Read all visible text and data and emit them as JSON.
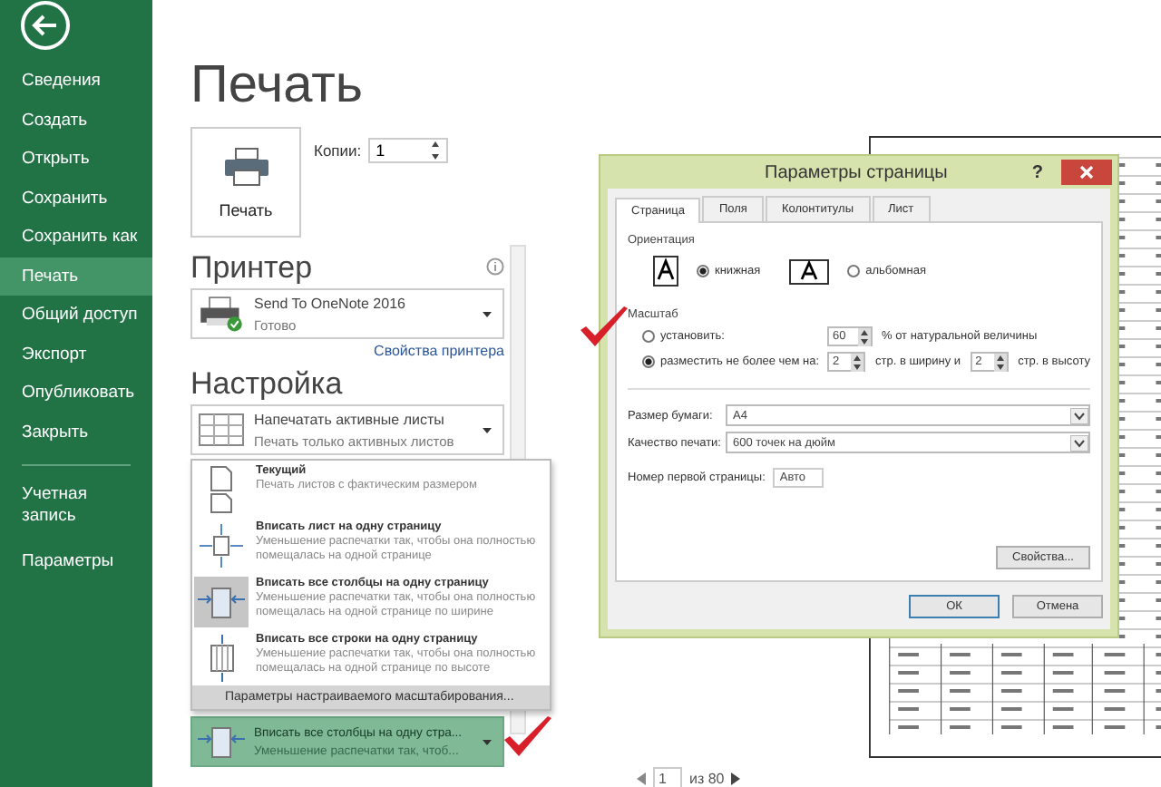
{
  "sidebar": {
    "items": [
      {
        "label": "Сведения",
        "selected": false
      },
      {
        "label": "Создать",
        "selected": false
      },
      {
        "label": "Открыть",
        "selected": false
      },
      {
        "label": "Сохранить",
        "selected": false
      },
      {
        "label": "Сохранить как",
        "selected": false
      },
      {
        "label": "Печать",
        "selected": true
      },
      {
        "label": "Общий доступ",
        "selected": false
      },
      {
        "label": "Экспорт",
        "selected": false
      },
      {
        "label": "Опубликовать",
        "selected": false
      },
      {
        "label": "Закрыть",
        "selected": false
      }
    ],
    "footer_items": [
      {
        "label": "Учетная запись",
        "selected": false
      },
      {
        "label": "Параметры",
        "selected": false
      }
    ]
  },
  "page_title": "Печать",
  "print_button": {
    "label": "Печать"
  },
  "copies": {
    "label": "Копии:",
    "value": "1"
  },
  "printer": {
    "heading": "Принтер",
    "name": "Send To OneNote 2016",
    "status": "Готово",
    "properties_link": "Свойства принтера"
  },
  "settings": {
    "heading": "Настройка",
    "dropdowns": [
      {
        "kind": "sheets",
        "title": "Напечатать активные листы",
        "subtitle": "Печать только активных листов",
        "highlighted": false
      },
      {
        "kind": "fit-columns",
        "title": "Вписать все столбцы на одну стра...",
        "subtitle": "Уменьшение распечатки так, чтоб...",
        "highlighted": true
      }
    ]
  },
  "scaling_menu": {
    "options": [
      {
        "kind": "actual",
        "title": "Текущий",
        "description": "Печать листов с фактическим размером",
        "selected": false
      },
      {
        "kind": "fit-sheet",
        "title": "Вписать лист на одну страницу",
        "description": "Уменьшение распечатки так, чтобы она полностью помещалась на одной странице",
        "selected": false
      },
      {
        "kind": "fit-columns",
        "title": "Вписать все столбцы на одну страницу",
        "description": "Уменьшение распечатки так, чтобы она полностью помещалась на одной странице по ширине",
        "selected": true
      },
      {
        "kind": "fit-rows",
        "title": "Вписать все строки на одну страницу",
        "description": "Уменьшение распечатки так, чтобы она полностью помещалась на одной странице по высоте",
        "selected": false
      }
    ],
    "custom_option": "Параметры настраиваемого масштабирования..."
  },
  "page_setup_dialog": {
    "title": "Параметры страницы",
    "help_button": "?",
    "tabs": [
      {
        "label": "Страница",
        "selected": true
      },
      {
        "label": "Поля",
        "selected": false
      },
      {
        "label": "Колонтитулы",
        "selected": false
      },
      {
        "label": "Лист",
        "selected": false
      }
    ],
    "orientation": {
      "label": "Ориентация",
      "options": [
        {
          "kind": "portrait",
          "label": "книжная",
          "selected": true
        },
        {
          "kind": "landscape",
          "label": "альбомная",
          "selected": false
        }
      ]
    },
    "scale": {
      "label": "Масштаб",
      "options": [
        {
          "label": "установить:",
          "selected": false,
          "parts": [
            {
              "kind": "field",
              "value": "60"
            },
            {
              "kind": "text",
              "value": "% от натуральной величины"
            }
          ]
        },
        {
          "label": "разместить не более чем на:",
          "selected": true,
          "parts": [
            {
              "kind": "field",
              "value": "2"
            },
            {
              "kind": "text",
              "value": "стр. в ширину и"
            },
            {
              "kind": "field",
              "value": "2"
            },
            {
              "kind": "text",
              "value": "стр. в высоту"
            }
          ]
        }
      ]
    },
    "paper_size": {
      "label": "Размер бумаги:",
      "value": "A4"
    },
    "print_quality": {
      "label": "Качество печати:",
      "value": "600 точек на дюйм"
    },
    "first_page_number": {
      "label": "Номер первой страницы:",
      "value": "Авто"
    },
    "properties_button": "Свойства...",
    "buttons": [
      {
        "label": "ОК",
        "default": true
      },
      {
        "label": "Отмена",
        "default": false
      }
    ]
  },
  "pagination": {
    "current": "1",
    "total": "из 80"
  }
}
